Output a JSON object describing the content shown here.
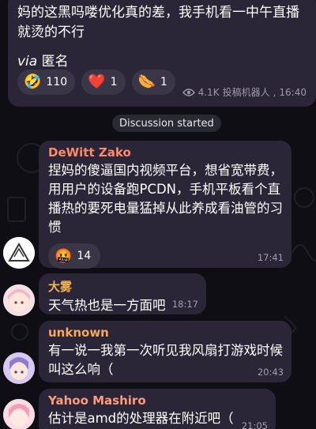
{
  "post": {
    "text": "妈的这黑吗喽优化真的差，我手机看一中午直播就烫的不行",
    "via_label": "via",
    "via_name": "匿名",
    "reactions": [
      {
        "emoji": "🤣",
        "count": "110"
      },
      {
        "emoji": "❤️",
        "count": "1"
      },
      {
        "emoji": "🌭",
        "count": "1"
      }
    ],
    "views": "4.1K",
    "author": "投稿机器人",
    "time": "16:40"
  },
  "divider": "Discussion started",
  "messages": [
    {
      "sender": "DeWitt Zako",
      "sender_color": "#ff8a6a",
      "text": "捏妈的傻逼国内视频平台，想省宽带费，用用户的设备跑PCDN，手机平板看个直播热的要死电量猛掉从此养成看油管的习惯",
      "reaction_emoji": "🤬",
      "reaction_count": "14",
      "time": "17:41"
    },
    {
      "sender": "大雾",
      "sender_color": "#f2b24e",
      "text": "天气热也是一方面吧",
      "time": "18:17"
    },
    {
      "sender": "unknown",
      "sender_color": "#f7a85c",
      "text": "有一说一我第一次听见我风扇打游戏时候叫这么响（",
      "time": "20:43"
    },
    {
      "sender": "Yahoo Mashiro",
      "sender_color": "#ff9a7c",
      "text": "估计是amd的处理器在附近吧（",
      "time": "21:05"
    }
  ],
  "colors": {
    "bubble": "#2b2637",
    "background": "#0e0e14",
    "meta": "#9d98aa"
  }
}
